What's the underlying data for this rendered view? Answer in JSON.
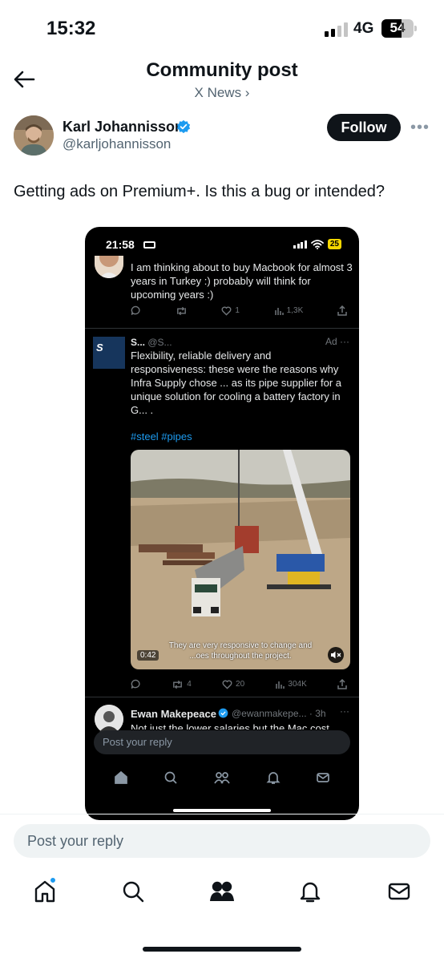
{
  "status_bar": {
    "time": "15:32",
    "network": "4G",
    "battery": "54"
  },
  "header": {
    "title": "Community post",
    "subtitle": "X News ›"
  },
  "author": {
    "name": "Karl Johannisson",
    "handle": "@karljohannisson",
    "follow_label": "Follow"
  },
  "post": {
    "text": "Getting ads on Premium+. Is this a bug or intended?"
  },
  "screenshot": {
    "status_time": "21:58",
    "status_battery": "25",
    "tweet1": {
      "text": "I am thinking about to buy Macbook for almost 3 years in Turkey :) probably will think for upcoming years :)",
      "likes": "1",
      "views": "1,3K"
    },
    "ad": {
      "name": "S...",
      "handle": "@S...",
      "ad_label": "Ad",
      "logo_text": "S",
      "text": "Flexibility, reliable delivery and responsiveness: these were the reasons why Infra Supply chose ... as its pipe supplier for a unique solution for cooling a battery factory in G... .",
      "hashtags": "#steel #pipes",
      "caption": "They are very responsive to change and ...oes throughout the project.",
      "duration": "0:42",
      "retweets": "4",
      "likes": "20",
      "views": "304K"
    },
    "tweet3": {
      "name": "Ewan Makepeace",
      "handle": "@ewanmakepe... · 3h",
      "text": "Not just the lower salaries but the Mac cost"
    },
    "reply_placeholder": "Post your reply"
  },
  "reply": {
    "placeholder": "Post your reply"
  },
  "tabs": [
    "home-icon",
    "search-icon",
    "communities-icon",
    "notifications-icon",
    "messages-icon"
  ],
  "colors": {
    "accent": "#1d9bf0",
    "text": "#0f1419",
    "muted": "#536471",
    "dark_bg": "#000000"
  }
}
